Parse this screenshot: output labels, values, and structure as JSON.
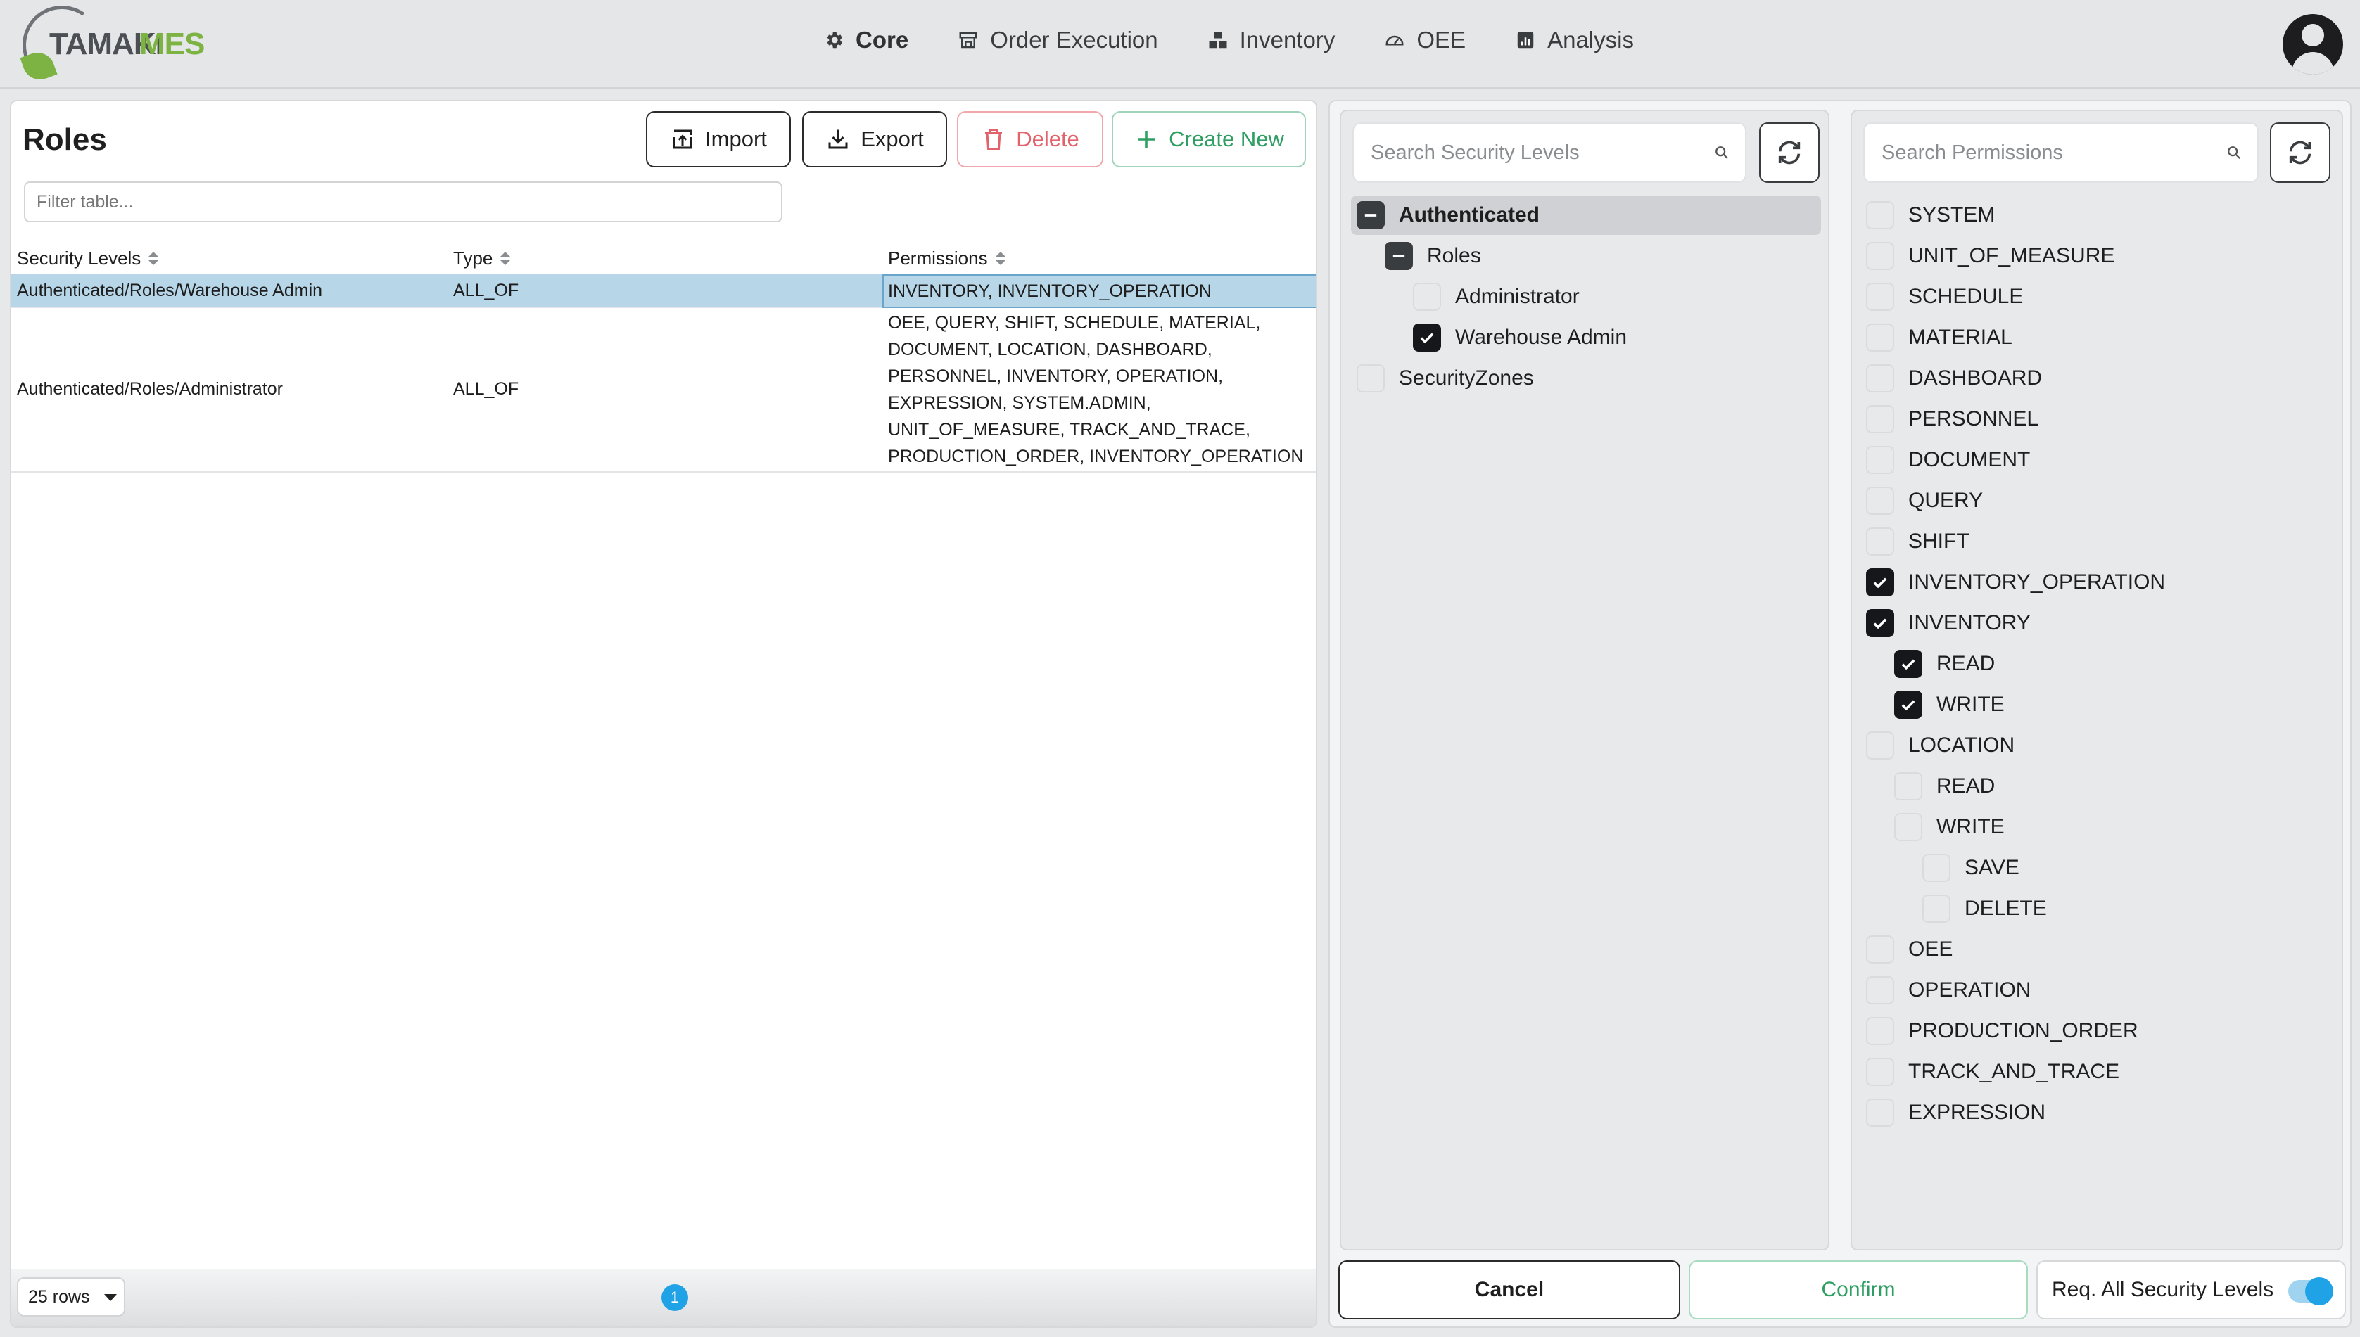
{
  "brand": {
    "part1": "TAMAKI",
    "part2": "MES"
  },
  "nav": [
    {
      "label": "Core",
      "icon": "gear-icon",
      "active": true
    },
    {
      "label": "Order Execution",
      "icon": "store-icon",
      "active": false
    },
    {
      "label": "Inventory",
      "icon": "boxes-icon",
      "active": false
    },
    {
      "label": "OEE",
      "icon": "gauge-icon",
      "active": false
    },
    {
      "label": "Analysis",
      "icon": "chart-icon",
      "active": false
    }
  ],
  "roles": {
    "title": "Roles",
    "buttons": {
      "import": "Import",
      "export": "Export",
      "delete": "Delete",
      "create": "Create New"
    },
    "filter_placeholder": "Filter table...",
    "columns": [
      "Security Levels",
      "Type",
      "Permissions"
    ],
    "rows": [
      {
        "security_level": "Authenticated/Roles/Warehouse Admin",
        "type": "ALL_OF",
        "permissions": [
          "INVENTORY, INVENTORY_OPERATION"
        ],
        "selected": true
      },
      {
        "security_level": "Authenticated/Roles/Administrator",
        "type": "ALL_OF",
        "permissions": [
          "OEE, QUERY, SHIFT, SCHEDULE, MATERIAL,",
          "DOCUMENT, LOCATION, DASHBOARD,",
          "PERSONNEL, INVENTORY, OPERATION,",
          "EXPRESSION, SYSTEM.ADMIN,",
          "UNIT_OF_MEASURE, TRACK_AND_TRACE,",
          "PRODUCTION_ORDER, INVENTORY_OPERATION"
        ],
        "selected": false
      }
    ],
    "rows_per_page": "25 rows",
    "current_page": "1"
  },
  "security_levels": {
    "search_placeholder": "Search Security Levels",
    "tree": [
      {
        "label": "Authenticated",
        "depth": 0,
        "state": "partial",
        "bold": true
      },
      {
        "label": "Roles",
        "depth": 1,
        "state": "partial",
        "bold": false
      },
      {
        "label": "Administrator",
        "depth": 2,
        "state": "unchecked",
        "bold": false
      },
      {
        "label": "Warehouse Admin",
        "depth": 2,
        "state": "checked",
        "bold": false
      },
      {
        "label": "SecurityZones",
        "depth": 0,
        "state": "unchecked",
        "bold": false
      }
    ]
  },
  "permissions": {
    "search_placeholder": "Search Permissions",
    "tree": [
      {
        "label": "SYSTEM",
        "depth": 0,
        "state": "unchecked"
      },
      {
        "label": "UNIT_OF_MEASURE",
        "depth": 0,
        "state": "unchecked"
      },
      {
        "label": "SCHEDULE",
        "depth": 0,
        "state": "unchecked"
      },
      {
        "label": "MATERIAL",
        "depth": 0,
        "state": "unchecked"
      },
      {
        "label": "DASHBOARD",
        "depth": 0,
        "state": "unchecked"
      },
      {
        "label": "PERSONNEL",
        "depth": 0,
        "state": "unchecked"
      },
      {
        "label": "DOCUMENT",
        "depth": 0,
        "state": "unchecked"
      },
      {
        "label": "QUERY",
        "depth": 0,
        "state": "unchecked"
      },
      {
        "label": "SHIFT",
        "depth": 0,
        "state": "unchecked"
      },
      {
        "label": "INVENTORY_OPERATION",
        "depth": 0,
        "state": "checked"
      },
      {
        "label": "INVENTORY",
        "depth": 0,
        "state": "checked"
      },
      {
        "label": "READ",
        "depth": 1,
        "state": "checked"
      },
      {
        "label": "WRITE",
        "depth": 1,
        "state": "checked"
      },
      {
        "label": "LOCATION",
        "depth": 0,
        "state": "unchecked"
      },
      {
        "label": "READ",
        "depth": 1,
        "state": "unchecked"
      },
      {
        "label": "WRITE",
        "depth": 1,
        "state": "unchecked"
      },
      {
        "label": "SAVE",
        "depth": 2,
        "state": "unchecked"
      },
      {
        "label": "DELETE",
        "depth": 2,
        "state": "unchecked"
      },
      {
        "label": "OEE",
        "depth": 0,
        "state": "unchecked"
      },
      {
        "label": "OPERATION",
        "depth": 0,
        "state": "unchecked"
      },
      {
        "label": "PRODUCTION_ORDER",
        "depth": 0,
        "state": "unchecked"
      },
      {
        "label": "TRACK_AND_TRACE",
        "depth": 0,
        "state": "unchecked"
      },
      {
        "label": "EXPRESSION",
        "depth": 0,
        "state": "unchecked"
      }
    ]
  },
  "actions": {
    "cancel": "Cancel",
    "confirm": "Confirm",
    "require_all_label": "Req. All Security Levels",
    "require_all_on": true
  },
  "colors": {
    "accent": "#1fa3e6",
    "selected_row": "#b7d6e8",
    "create_green": "#2e9e62",
    "delete_red": "#e2636c",
    "brand_green": "#7cb342"
  }
}
